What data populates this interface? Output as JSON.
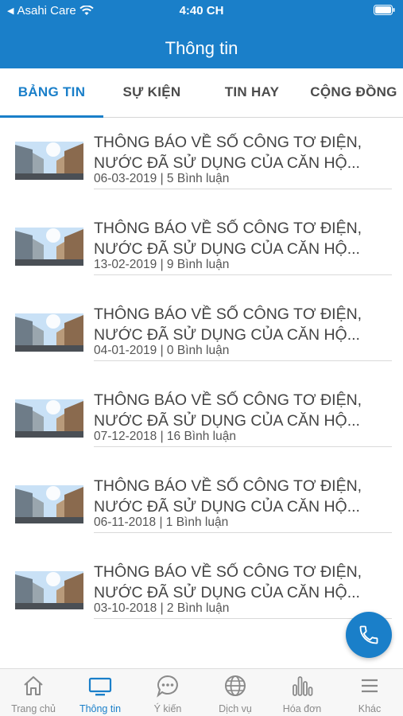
{
  "status_bar": {
    "carrier": "Asahi Care",
    "time": "4:40 CH"
  },
  "header": {
    "title": "Thông tin"
  },
  "tabs": [
    {
      "label": "BẢNG TIN",
      "active": true
    },
    {
      "label": "SỰ KIỆN",
      "active": false
    },
    {
      "label": "TIN HAY",
      "active": false
    },
    {
      "label": "CỘNG ĐỒNG",
      "active": false
    }
  ],
  "news": [
    {
      "title_line1": "THÔNG BÁO VỀ SỐ CÔNG TƠ ĐIỆN,",
      "title_line2": "NƯỚC ĐÃ SỬ DỤNG CỦA CĂN HỘ...",
      "meta": "06-03-2019 | 5 Bình luận"
    },
    {
      "title_line1": "THÔNG BÁO VỀ SỐ CÔNG TƠ ĐIỆN,",
      "title_line2": "NƯỚC ĐÃ SỬ DỤNG CỦA CĂN HỘ...",
      "meta": "13-02-2019 | 9 Bình luận"
    },
    {
      "title_line1": "THÔNG BÁO VỀ SỐ CÔNG TƠ ĐIỆN,",
      "title_line2": "NƯỚC ĐÃ SỬ DỤNG CỦA CĂN HỘ...",
      "meta": "04-01-2019 | 0 Bình luận"
    },
    {
      "title_line1": "THÔNG BÁO VỀ SỐ CÔNG TƠ ĐIỆN,",
      "title_line2": "NƯỚC ĐÃ SỬ DỤNG CỦA CĂN HỘ...",
      "meta": "07-12-2018 | 16 Bình luận"
    },
    {
      "title_line1": "THÔNG BÁO VỀ SỐ CÔNG TƠ ĐIỆN,",
      "title_line2": "NƯỚC ĐÃ SỬ DỤNG CỦA CĂN HỘ...",
      "meta": "06-11-2018 | 1 Bình luận"
    },
    {
      "title_line1": "THÔNG BÁO VỀ SỐ CÔNG TƠ ĐIỆN,",
      "title_line2": "NƯỚC ĐÃ SỬ DỤNG CỦA CĂN HỘ...",
      "meta": "03-10-2018 | 2 Bình luận"
    }
  ],
  "fab": {
    "icon": "phone-icon"
  },
  "bottom_nav": [
    {
      "label": "Trang chủ",
      "icon": "home-icon",
      "active": false
    },
    {
      "label": "Thông tin",
      "icon": "monitor-icon",
      "active": true
    },
    {
      "label": "Ý kiến",
      "icon": "chat-icon",
      "active": false
    },
    {
      "label": "Dịch vụ",
      "icon": "globe-icon",
      "active": false
    },
    {
      "label": "Hóa đơn",
      "icon": "bar-chart-icon",
      "active": false
    },
    {
      "label": "Khác",
      "icon": "menu-icon",
      "active": false
    }
  ],
  "colors": {
    "primary": "#1a7fc9",
    "text": "#444444",
    "inactive": "#8a8a8a"
  }
}
